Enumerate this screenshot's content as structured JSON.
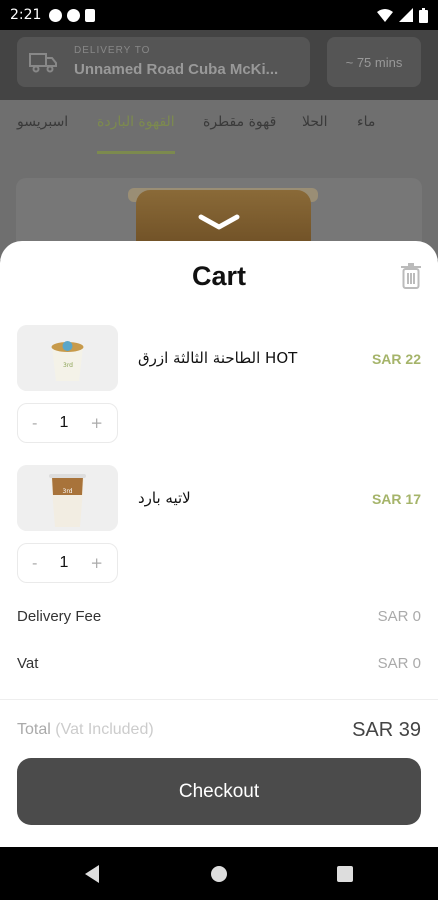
{
  "status_bar": {
    "time": "2:21"
  },
  "header": {
    "delivery_label": "DELIVERY TO",
    "delivery_address": "Unnamed Road Cuba McKi...",
    "eta": "~ 75 mins"
  },
  "tabs": [
    {
      "label": "ماء"
    },
    {
      "label": "الحلا"
    },
    {
      "label": "قهوة مقطرة"
    },
    {
      "label": "القهوة الباردة"
    },
    {
      "label": "اسبريسو"
    }
  ],
  "cart": {
    "title": "Cart",
    "items": [
      {
        "name": "الطاحنة الثالثة ازرق HOT",
        "price": "SAR 22",
        "quantity": "1"
      },
      {
        "name": "لاتيه بارد",
        "price": "SAR 17",
        "quantity": "1"
      }
    ],
    "stepper": {
      "minus": "-",
      "plus": "+"
    },
    "delivery_fee_label": "Delivery Fee",
    "delivery_fee_value": "SAR 0",
    "vat_label": "Vat",
    "vat_value": "SAR 0",
    "total_label": "Total",
    "total_sub": "(Vat Included)",
    "total_value": "SAR 39",
    "checkout_label": "Checkout"
  },
  "colors": {
    "accent": "#a5b46a",
    "button": "#4b4b4b"
  }
}
